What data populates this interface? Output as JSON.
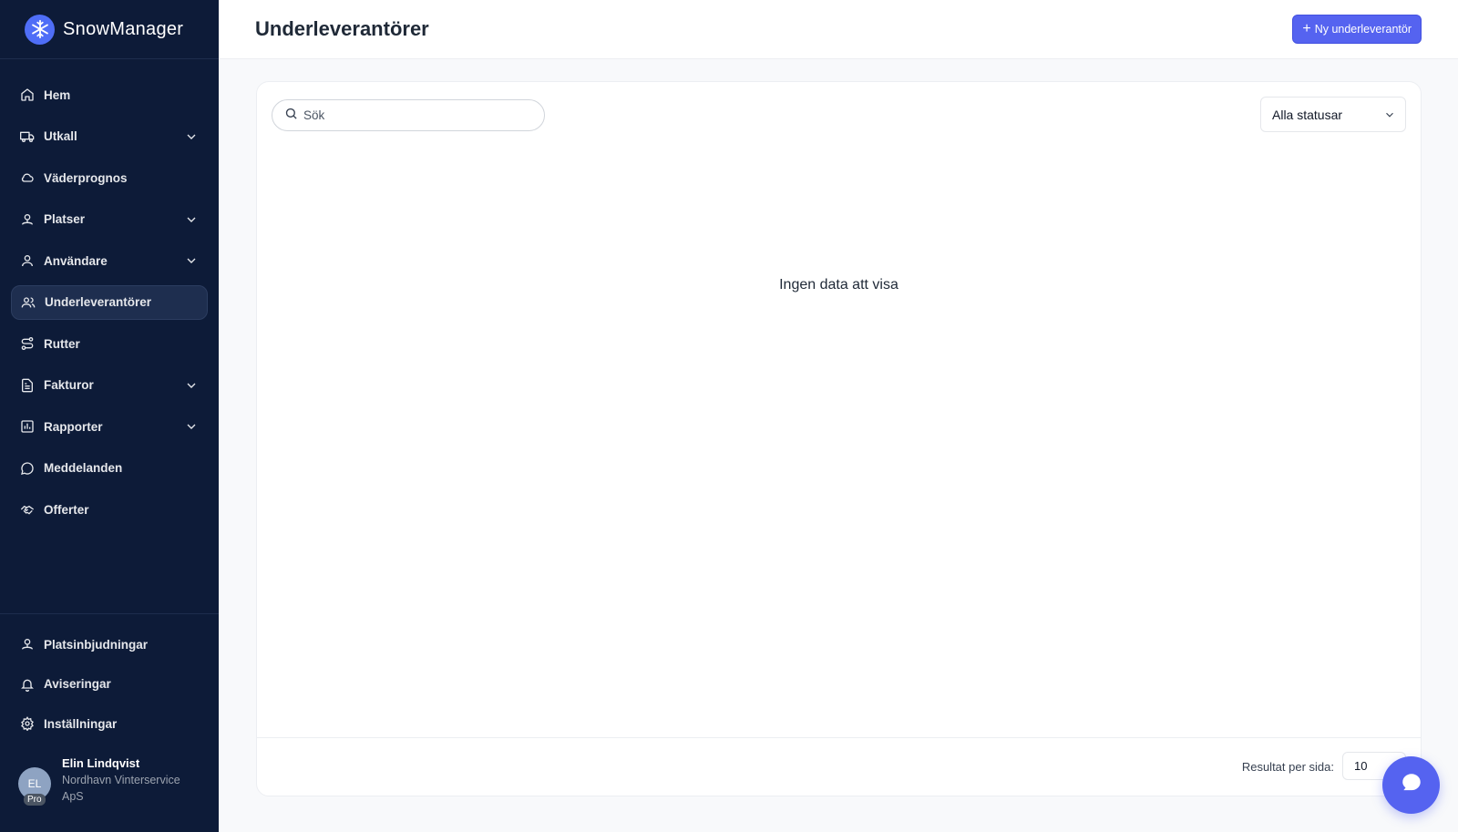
{
  "brand": {
    "name": "SnowManager",
    "accent": "#4f6ef7"
  },
  "nav": [
    {
      "label": "Hem",
      "icon": "home-icon",
      "chevron": false
    },
    {
      "label": "Utkall",
      "icon": "truck-icon",
      "chevron": true
    },
    {
      "label": "Väderprognos",
      "icon": "cloud-icon",
      "chevron": false
    },
    {
      "label": "Platser",
      "icon": "map-pin-icon",
      "chevron": true
    },
    {
      "label": "Användare",
      "icon": "user-icon",
      "chevron": true
    },
    {
      "label": "Underleverantörer",
      "icon": "users-icon",
      "chevron": false,
      "active": true
    },
    {
      "label": "Rutter",
      "icon": "route-icon",
      "chevron": false
    },
    {
      "label": "Fakturor",
      "icon": "invoice-icon",
      "chevron": true
    },
    {
      "label": "Rapporter",
      "icon": "bar-chart-icon",
      "chevron": true
    },
    {
      "label": "Meddelanden",
      "icon": "message-icon",
      "chevron": false
    },
    {
      "label": "Offerter",
      "icon": "handshake-icon",
      "chevron": false
    }
  ],
  "bottom_nav": [
    {
      "label": "Platsinbjudningar",
      "icon": "map-pin-icon"
    },
    {
      "label": "Aviseringar",
      "icon": "bell-icon"
    },
    {
      "label": "Inställningar",
      "icon": "gear-icon"
    }
  ],
  "user": {
    "initials": "EL",
    "badge": "Pro",
    "name": "Elin Lindqvist",
    "company": "Nordhavn Vinterservice ApS"
  },
  "header": {
    "title": "Underleverantörer",
    "new_button": "Ny underleverantör",
    "plus": "+"
  },
  "filters": {
    "search_placeholder": "Sök",
    "search_value": "",
    "status_selected": "Alla statusar"
  },
  "main": {
    "empty_text": "Ingen data att visa"
  },
  "footer": {
    "per_page_label": "Resultat per sida:",
    "per_page_value": "10"
  },
  "colors": {
    "sidebar": "#0d1b38",
    "primary": "#5563f0"
  }
}
